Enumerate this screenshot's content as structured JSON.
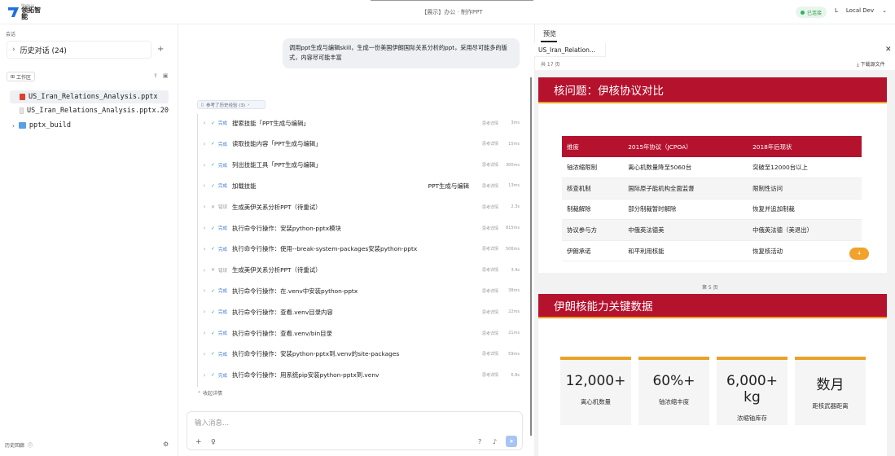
{
  "header": {
    "logo_small": "Made in",
    "logo_big": "领拓智能",
    "title": "【展示】办公 · 制作PPT",
    "status": "已连接",
    "user_initial": "L",
    "user_name": "Local Dev"
  },
  "sidebar": {
    "section_label": "会话",
    "history_label": "历史对话 (24)",
    "workspace_label": "工作区",
    "files": [
      "US_Iran_Relations_Analysis.pptx",
      "US_Iran_Relations_Analysis.pptx.20",
      "pptx_build"
    ],
    "bottom_label": "历史回廊"
  },
  "chat": {
    "user_message": "调用ppt生成与编辑skill，生成一份美国伊朗国际关系分析的ppt，采用尽可能多的版式，内容尽可能丰富",
    "ref_label": "参考了历史经验 (3)",
    "steps": [
      {
        "status": "ok",
        "tag": "完成",
        "name": "搜索技能「PPT生成与编辑」",
        "extra": "",
        "detail": "思考详情",
        "time": "3ms"
      },
      {
        "status": "ok",
        "tag": "完成",
        "name": "读取技能内容「PPT生成与编辑」",
        "extra": "",
        "detail": "思考详情",
        "time": "15ms"
      },
      {
        "status": "ok",
        "tag": "完成",
        "name": "列出技能工具「PPT生成与编辑」",
        "extra": "",
        "detail": "思考详情",
        "time": "300ms"
      },
      {
        "status": "ok",
        "tag": "完成",
        "name": "加载技能",
        "extra": "PPT生成与编辑",
        "detail": "思考详情",
        "time": "13ms"
      },
      {
        "status": "fail",
        "tag": "错误",
        "name": "生成美伊关系分析PPT（待重试）",
        "extra": "",
        "detail": "思考详情",
        "time": "2.3s"
      },
      {
        "status": "ok",
        "tag": "完成",
        "name": "执行命令行操作：安装python-pptx模块",
        "extra": "",
        "detail": "思考详情",
        "time": "815ms"
      },
      {
        "status": "ok",
        "tag": "完成",
        "name": "执行命令行操作：使用--break-system-packages安装python-pptx",
        "extra": "",
        "detail": "思考详情",
        "time": "506ms"
      },
      {
        "status": "fail",
        "tag": "错误",
        "name": "生成美伊关系分析PPT（待重试）",
        "extra": "",
        "detail": "思考详情",
        "time": "3.4s"
      },
      {
        "status": "ok",
        "tag": "完成",
        "name": "执行命令行操作：在.venv中安装python-pptx",
        "extra": "",
        "detail": "思考详情",
        "time": "38ms"
      },
      {
        "status": "ok",
        "tag": "完成",
        "name": "执行命令行操作：查看.venv目录内容",
        "extra": "",
        "detail": "思考详情",
        "time": "22ms"
      },
      {
        "status": "ok",
        "tag": "完成",
        "name": "执行命令行操作：查看.venv/bin目录",
        "extra": "",
        "detail": "思考详情",
        "time": "21ms"
      },
      {
        "status": "ok",
        "tag": "完成",
        "name": "执行命令行操作：安装python-pptx到.venv的site-packages",
        "extra": "",
        "detail": "思考详情",
        "time": "59ms"
      },
      {
        "status": "ok",
        "tag": "完成",
        "name": "执行命令行操作：用系统pip安装python-pptx到.venv",
        "extra": "",
        "detail": "思考详情",
        "time": "6.8s"
      }
    ],
    "collapse_label": "收起详情",
    "input_placeholder": "输入消息..."
  },
  "preview": {
    "tab_label": "预览",
    "file_tab": "US_Iran_Relation...",
    "page_count": "共 17 页",
    "download_label": "下载源文件",
    "slide1": {
      "title": "核问题：伊核协议对比",
      "headers": [
        "维度",
        "2015年协议（JCPOA）",
        "2018年后现状"
      ],
      "rows": [
        [
          "铀浓缩限制",
          "离心机数量降至5060台",
          "突破至12000台以上"
        ],
        [
          "核查机制",
          "国际原子能机构全面监督",
          "限制性访问"
        ],
        [
          "制裁解除",
          "部分制裁暂时解除",
          "恢复并追加制裁"
        ],
        [
          "协议参与方",
          "中俄英法德美",
          "中俄英法德（美退出）"
        ],
        [
          "伊朗承诺",
          "和平利用核能",
          "恢复核活动"
        ]
      ],
      "badge": "4"
    },
    "page_label": "第 5 页",
    "slide2": {
      "title": "伊朗核能力关键数据",
      "cards": [
        {
          "value": "12,000+",
          "label": "离心机数量"
        },
        {
          "value": "60%+",
          "label": "铀浓缩丰度"
        },
        {
          "value": "6,000+ kg",
          "label": "浓缩铀库存"
        },
        {
          "value": "数月",
          "label": "距核武器距离"
        }
      ]
    }
  },
  "colors": {
    "accent_red": "#b5122e",
    "accent_gold": "#e9a227",
    "brand_blue": "#1d6fe0",
    "ok_green": "#2ab55a"
  }
}
